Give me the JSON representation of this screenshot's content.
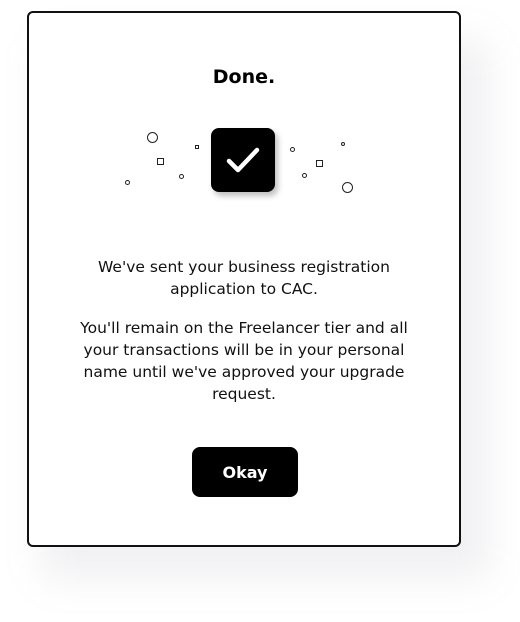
{
  "dialog": {
    "title": "Done.",
    "message_primary": "We've sent your business registration application to CAC.",
    "message_secondary": "You'll remain on the Freelancer tier and all your transactions will be in your personal name until we've approved your upgrade request.",
    "okay_label": "Okay",
    "icon": "checkmark-icon"
  },
  "colors": {
    "accent": "#000000",
    "background": "#ffffff",
    "text": "#111111"
  }
}
